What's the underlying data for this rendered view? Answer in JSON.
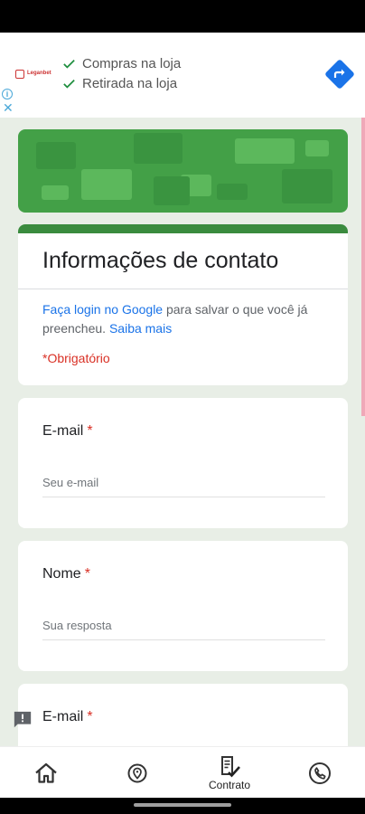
{
  "ad": {
    "logo_text": "Leganbet",
    "features": [
      "Compras na loja",
      "Retirada na loja"
    ],
    "info_icon": "info-icon",
    "close_symbol": "✕",
    "nav_icon": "directions-icon",
    "colors": {
      "check": "#1e8e3e",
      "nav": "#1a73e8"
    }
  },
  "form": {
    "header_color": "#43a047",
    "accent_color": "#3a8b3e",
    "title": "Informações de contato",
    "info_login_link": "Faça login no Google",
    "info_text": " para salvar o que você já preencheu. ",
    "info_more_link": "Saiba mais",
    "required_note": "*Obrigatório",
    "questions": [
      {
        "label": "E-mail",
        "required_mark": "*",
        "placeholder": "Seu e-mail"
      },
      {
        "label": "Nome",
        "required_mark": "*",
        "placeholder": "Sua resposta"
      },
      {
        "label": "E-mail",
        "required_mark": "*",
        "placeholder": ""
      }
    ]
  },
  "bottom_nav": {
    "items": [
      {
        "icon": "home-icon",
        "label": ""
      },
      {
        "icon": "location-icon",
        "label": ""
      },
      {
        "icon": "contract-icon",
        "label": "Contrato"
      },
      {
        "icon": "phone-icon",
        "label": ""
      }
    ]
  }
}
